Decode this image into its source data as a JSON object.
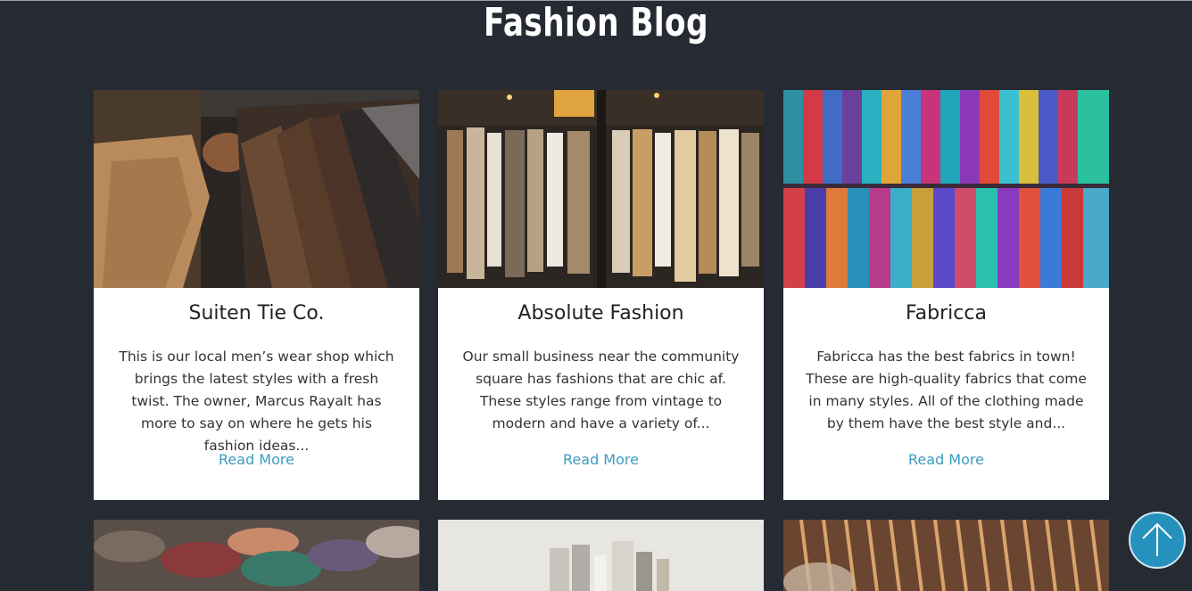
{
  "header": {
    "title": "Fashion Blog"
  },
  "cards": [
    {
      "title": "Suiten Tie Co.",
      "description": "This is our local men’s wear shop which brings the latest styles with a fresh twist. The owner, Marcus Rayalt has more to say on where he gets his fashion ideas...",
      "link_label": "Read More"
    },
    {
      "title": "Absolute Fashion",
      "description": "Our small business near the community square has fashions that are chic af. These styles range from vintage to modern and have a variety of...",
      "link_label": "Read More"
    },
    {
      "title": "Fabricca",
      "description": "Fabricca has the best fabrics in town! These are high-quality fabrics that come in many styles. All of the clothing made by them have the best style and...",
      "link_label": "Read More"
    }
  ],
  "scroll_top": {
    "icon": "arrow-up-icon"
  },
  "colors": {
    "background": "#262a33",
    "card": "#ffffff",
    "link": "#3b9cc2",
    "scroll_button": "#2691bd"
  }
}
